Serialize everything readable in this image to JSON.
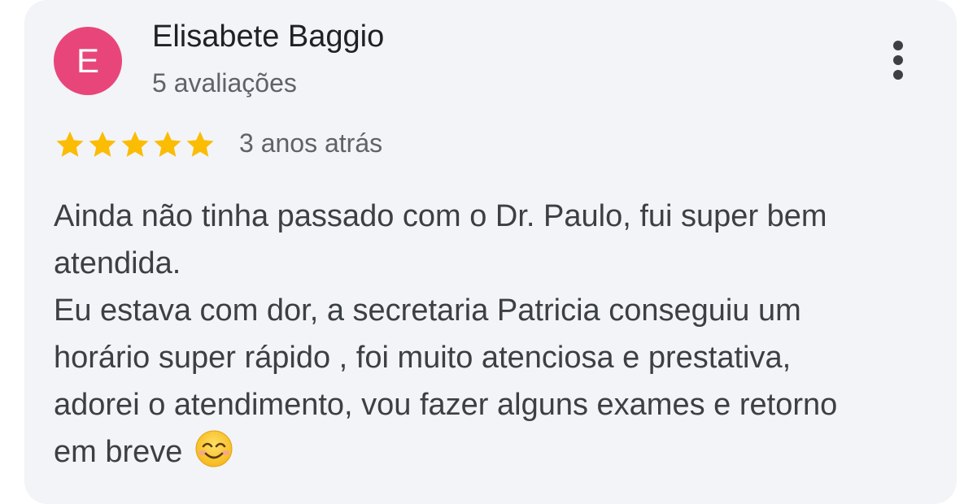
{
  "review": {
    "avatar_letter": "E",
    "avatar_color": "#e8467a",
    "author_name": "Elisabete Baggio",
    "author_review_count": "5 avaliações",
    "rating": 5,
    "rating_max": 5,
    "star_color": "#fbbc04",
    "time_ago": "3 anos atrás",
    "menu_icon": "more-vert-icon",
    "text_lines": [
      "Ainda não tinha passado com o Dr. Paulo, fui super bem",
      "atendida.",
      "Eu estava com dor, a secretaria Patricia conseguiu um",
      "horário super rápido , foi muito atenciosa e prestativa,",
      "adorei o atendimento, vou fazer alguns exames e retorno",
      "em breve"
    ],
    "trailing_emoji": "smiling-face-emoji"
  }
}
